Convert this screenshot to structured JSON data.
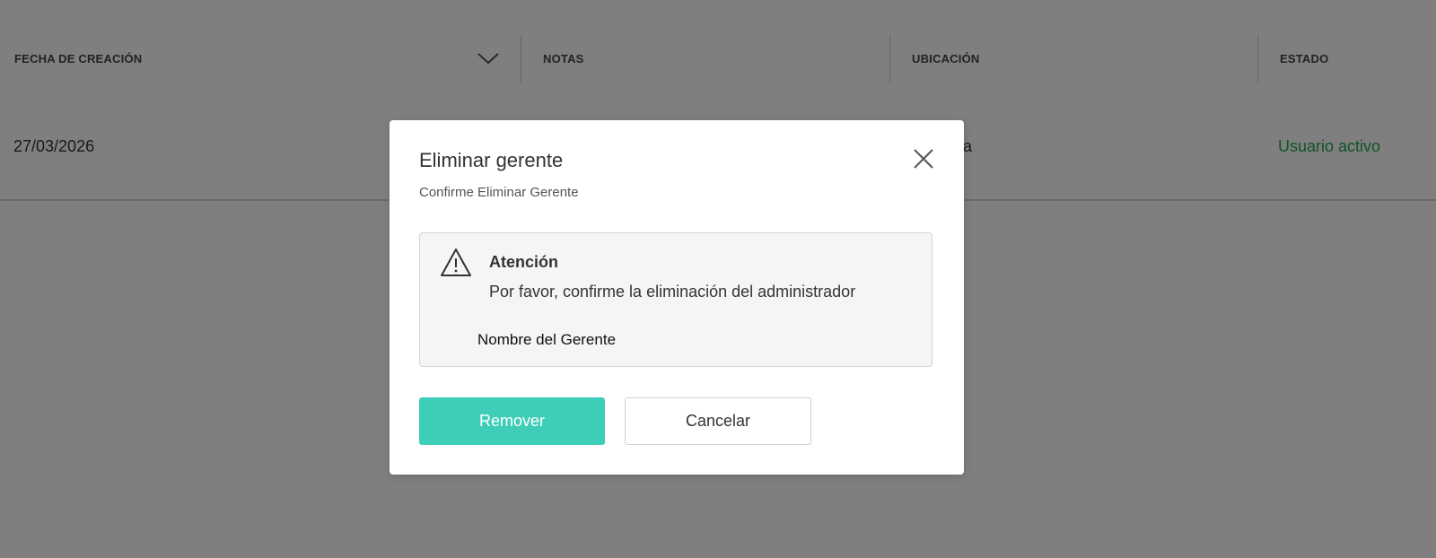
{
  "table": {
    "columns": [
      "FECHA DE CREACIÓN",
      "NOTAS",
      "UBICACIÓN",
      "ESTADO"
    ],
    "rows": [
      {
        "fecha": "27/03/2026",
        "ubicacion": "nala",
        "estado": "Usuario activo"
      }
    ],
    "sort_icon": "chevron-down-icon",
    "status_color": "#1fa84a"
  },
  "dialog": {
    "title": "Eliminar gerente",
    "subtitle": "Confirme Eliminar Gerente",
    "close_icon": "close-icon",
    "alert": {
      "icon": "warning-icon",
      "heading": "Atención",
      "message": "Por favor, confirme la eliminación del administrador",
      "name": "Nombre del Gerente"
    },
    "buttons": {
      "remove": "Remover",
      "cancel": "Cancelar"
    },
    "accent_color": "#3ecdb6"
  }
}
